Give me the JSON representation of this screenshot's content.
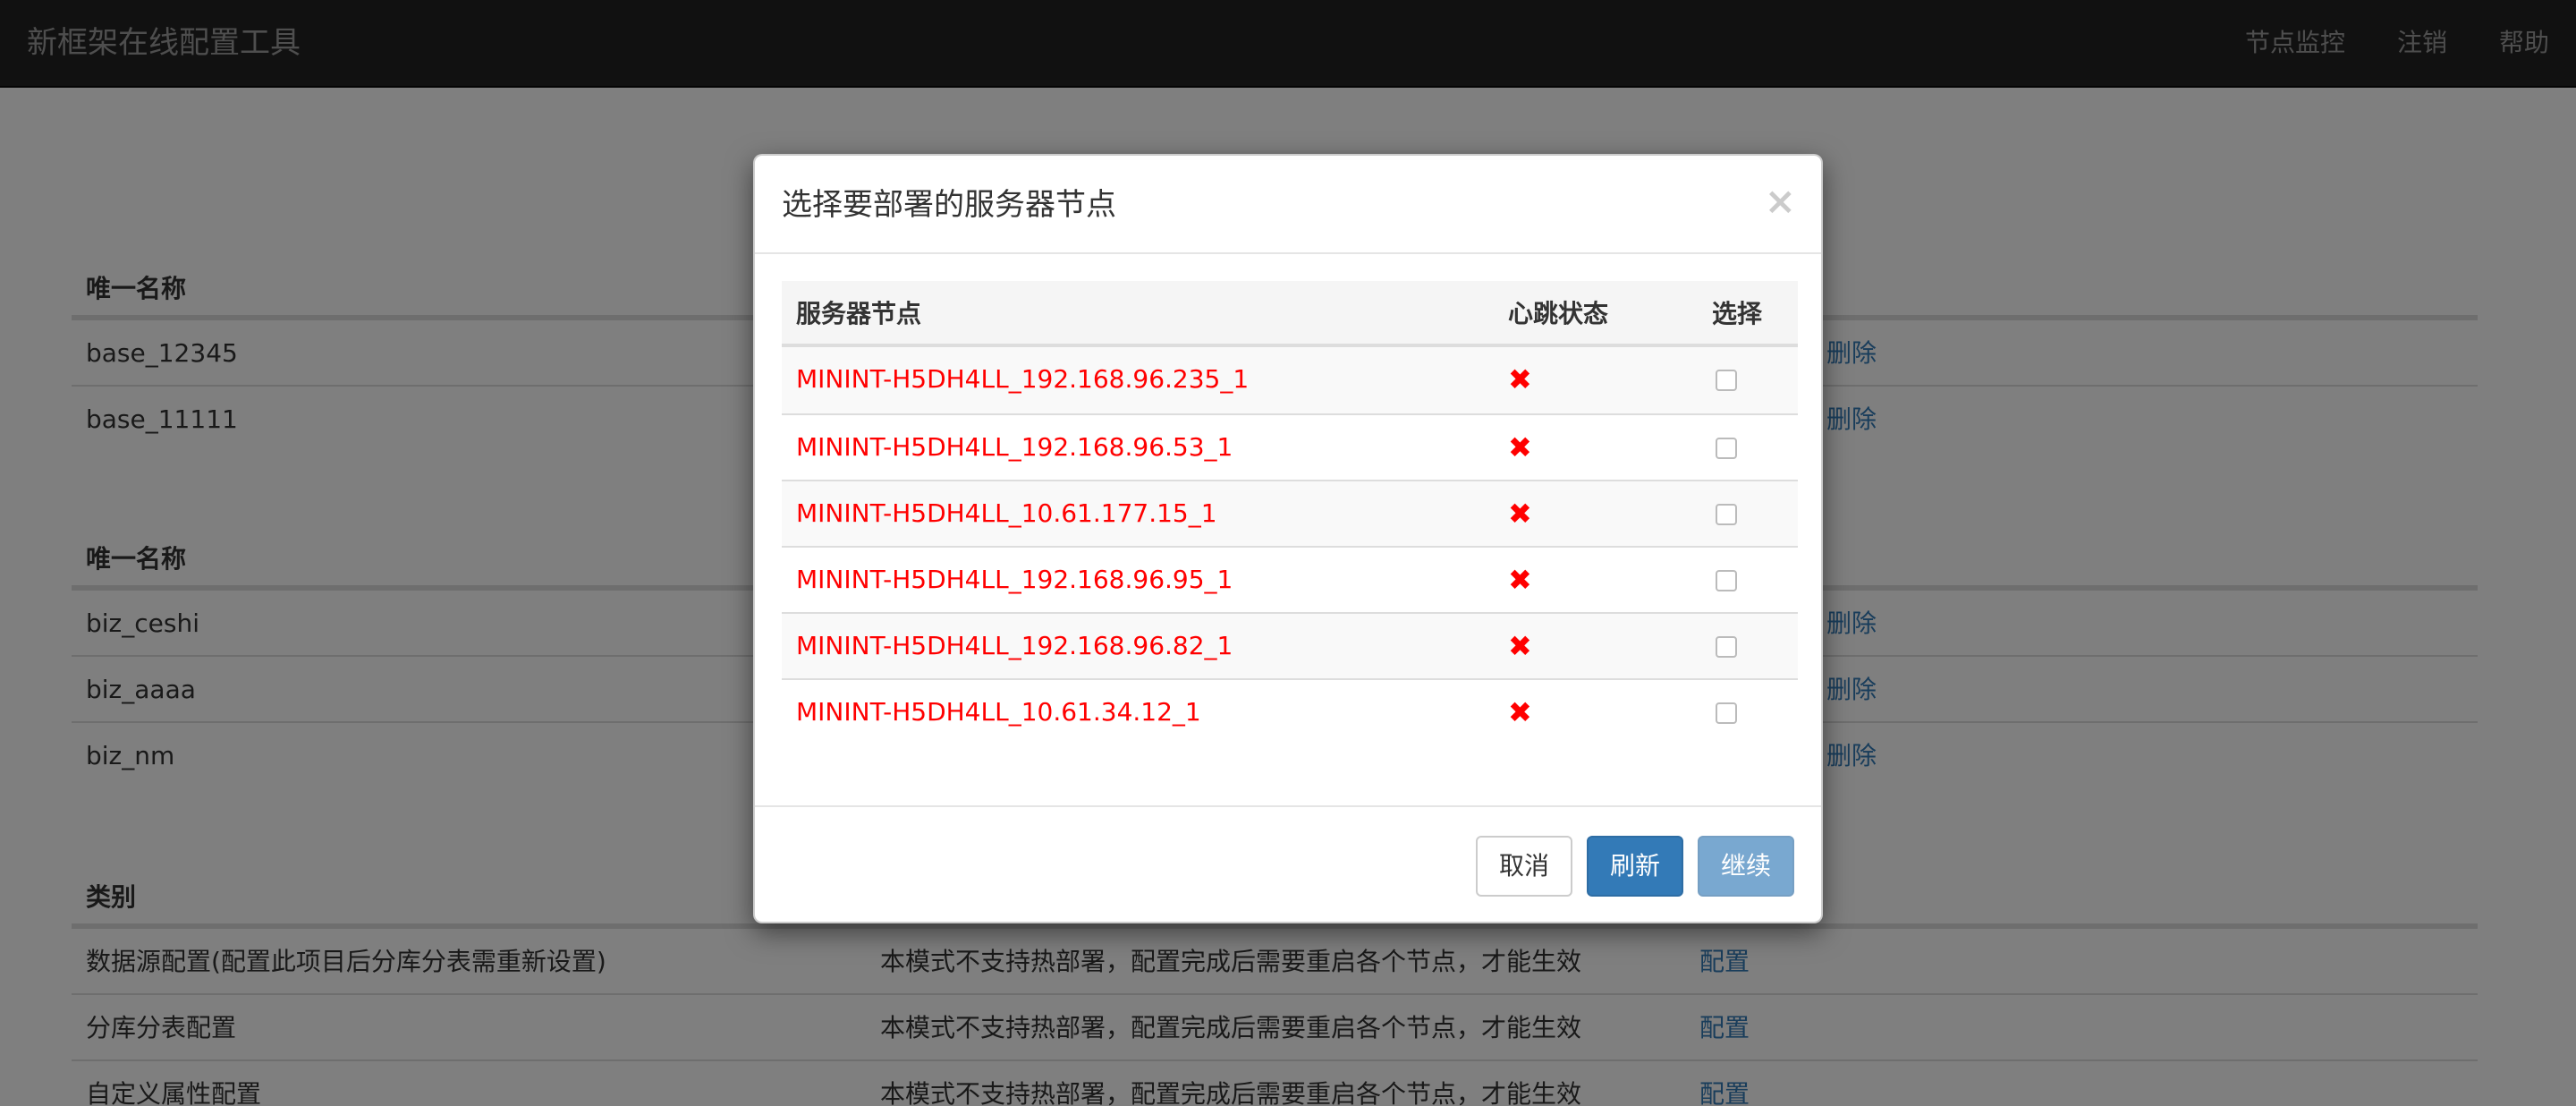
{
  "navbar": {
    "brand": "新框架在线配置工具",
    "links": [
      "节点监控",
      "注销",
      "帮助"
    ]
  },
  "section1": {
    "header": "唯一名称",
    "rows": [
      {
        "name": "base_12345",
        "action": "删除"
      },
      {
        "name": "base_11111",
        "action": "删除"
      }
    ]
  },
  "section2": {
    "header": "唯一名称",
    "rows": [
      {
        "name": "biz_ceshi",
        "action": "删除"
      },
      {
        "name": "biz_aaaa",
        "action": "删除"
      },
      {
        "name": "biz_nm",
        "action": "删除"
      }
    ]
  },
  "section3": {
    "header": "类别",
    "rows": [
      {
        "category": "数据源配置(配置此项目后分库分表需重新设置)",
        "desc": "本模式不支持热部署，配置完成后需要重启各个节点，才能生效",
        "action": "配置"
      },
      {
        "category": "分库分表配置",
        "desc": "本模式不支持热部署，配置完成后需要重启各个节点，才能生效",
        "action": "配置"
      },
      {
        "category": "自定义属性配置",
        "desc": "本模式不支持热部署，配置完成后需要重启各个节点，才能生效",
        "action": "配置"
      }
    ]
  },
  "modal": {
    "title": "选择要部署的服务器节点",
    "close": "×",
    "columns": [
      "服务器节点",
      "心跳状态",
      "选择"
    ],
    "nodes": [
      {
        "name": "MININT-H5DH4LL_192.168.96.235_1",
        "status": "✖"
      },
      {
        "name": "MININT-H5DH4LL_192.168.96.53_1",
        "status": "✖"
      },
      {
        "name": "MININT-H5DH4LL_10.61.177.15_1",
        "status": "✖"
      },
      {
        "name": "MININT-H5DH4LL_192.168.96.95_1",
        "status": "✖"
      },
      {
        "name": "MININT-H5DH4LL_192.168.96.82_1",
        "status": "✖"
      },
      {
        "name": "MININT-H5DH4LL_10.61.34.12_1",
        "status": "✖"
      }
    ],
    "buttons": {
      "cancel": "取消",
      "refresh": "刷新",
      "continue": "继续"
    }
  },
  "colors": {
    "navbar_bg": "#222222",
    "primary": "#337ab7",
    "danger": "#ff0000"
  }
}
